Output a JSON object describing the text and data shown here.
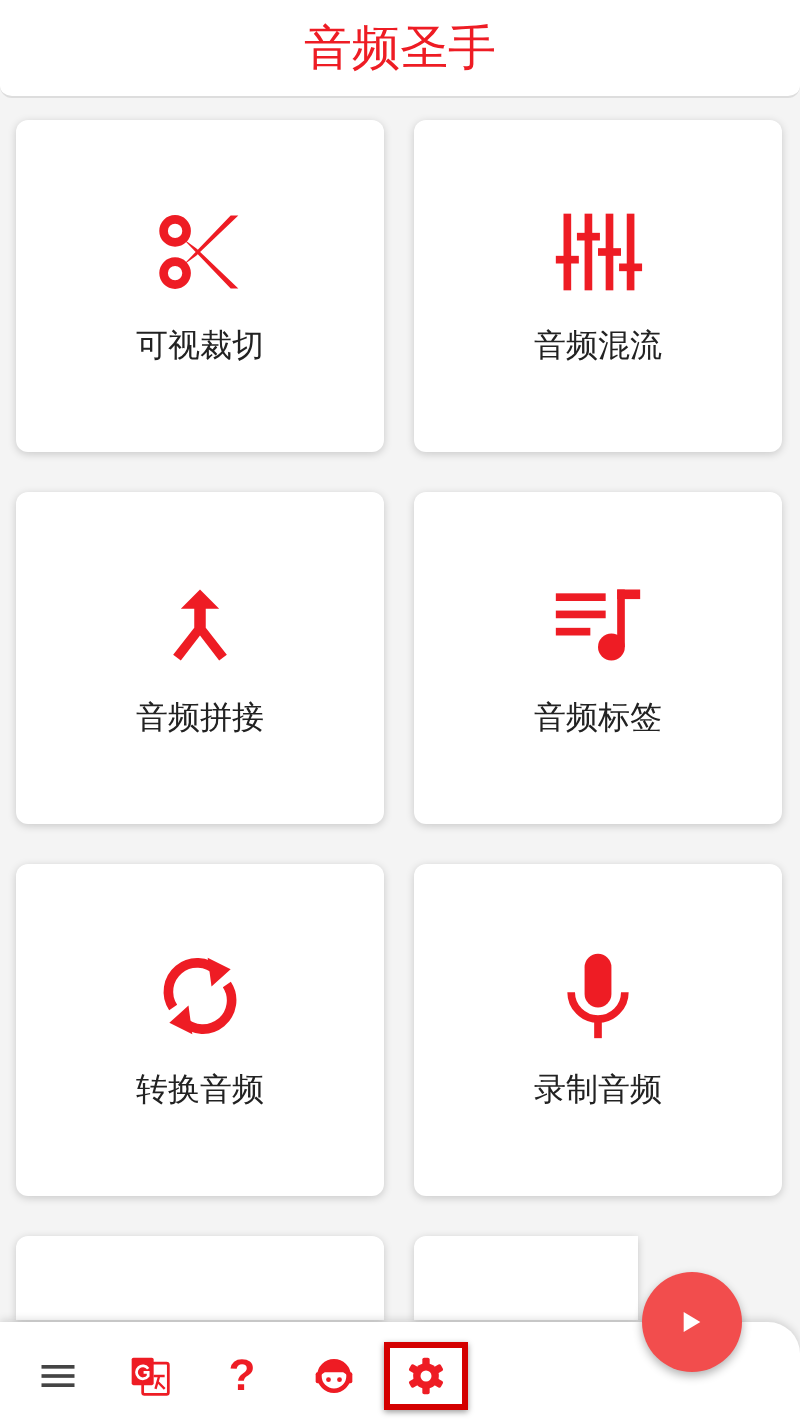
{
  "title": "音频圣手",
  "tools": [
    {
      "kind": "scissors",
      "label": "可视裁切"
    },
    {
      "kind": "sliders",
      "label": "音频混流"
    },
    {
      "kind": "merge",
      "label": "音频拼接"
    },
    {
      "kind": "playlist",
      "label": "音频标签"
    },
    {
      "kind": "sync",
      "label": "转换音频"
    },
    {
      "kind": "mic",
      "label": "录制音频"
    },
    {
      "kind": "empty"
    },
    {
      "kind": "empty"
    }
  ],
  "nav": [
    {
      "kind": "menu",
      "selected": false
    },
    {
      "kind": "translate",
      "selected": false
    },
    {
      "kind": "help",
      "glyph": "?",
      "selected": false
    },
    {
      "kind": "support",
      "selected": false
    },
    {
      "kind": "settings",
      "selected": true
    }
  ],
  "fab": {
    "kind": "play"
  }
}
